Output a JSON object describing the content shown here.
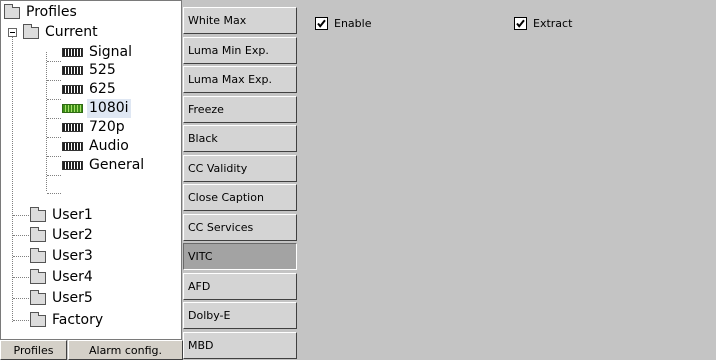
{
  "tree": {
    "root": "Profiles",
    "current": "Current",
    "current_items": [
      "Signal",
      "525",
      "625",
      "1080i",
      "720p",
      "Audio",
      "General"
    ],
    "selected_item": "1080i",
    "users": [
      "User1",
      "User2",
      "User3",
      "User4",
      "User5",
      "Factory"
    ]
  },
  "bottom_buttons": {
    "profiles": "Profiles",
    "alarm_config": "Alarm config."
  },
  "tabs": [
    "White Max",
    "Luma Min Exp.",
    "Luma Max Exp.",
    "Freeze",
    "Black",
    "CC Validity",
    "Close Caption",
    "CC Services",
    "VITC",
    "AFD",
    "Dolby-E",
    "MBD"
  ],
  "selected_tab": "VITC",
  "content": {
    "enable_label": "Enable",
    "enable_checked": true,
    "extract_label": "Extract",
    "extract_checked": true
  }
}
